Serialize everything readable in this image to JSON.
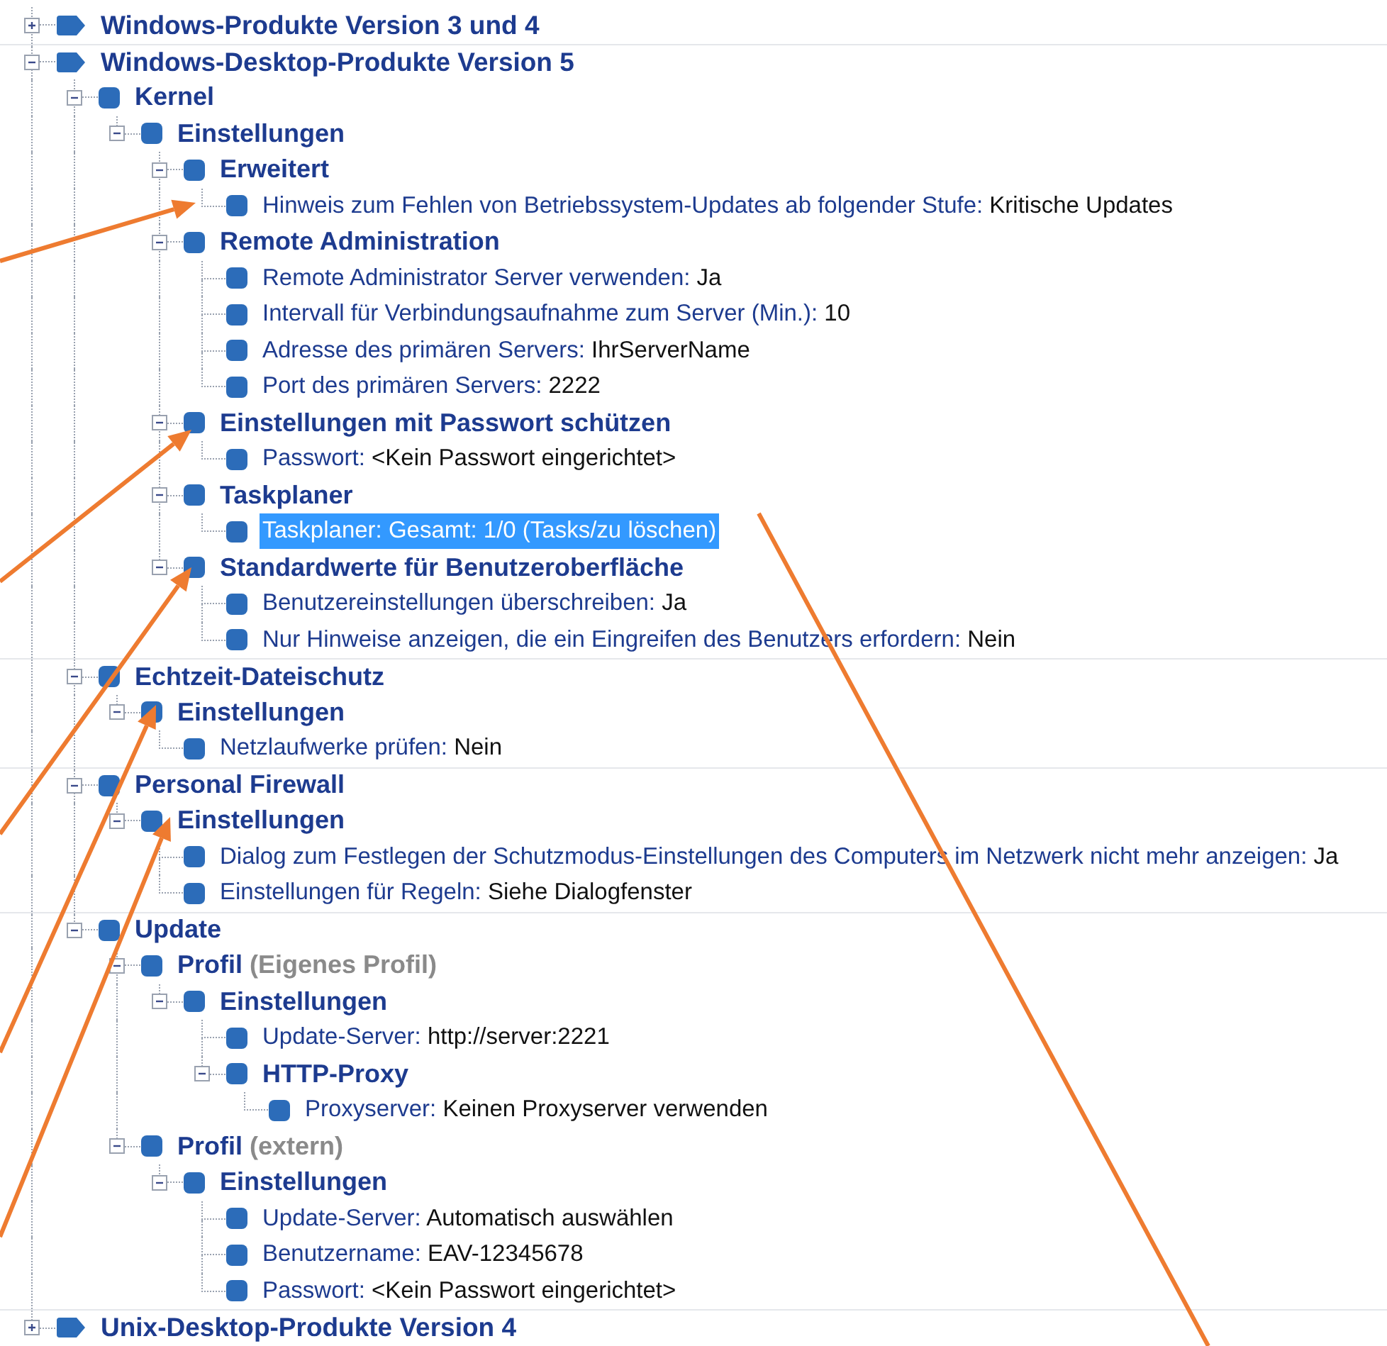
{
  "tree": [
    {
      "kind": "product",
      "label": "Windows-Produkte Version 3 und 4",
      "expanded": false,
      "selected": false
    },
    {
      "kind": "product",
      "label": "Windows-Desktop-Produkte Version 5",
      "expanded": true,
      "selected": false,
      "children": [
        {
          "kind": "group",
          "label": "Kernel",
          "expanded": true,
          "selected": false,
          "children": [
            {
              "kind": "group",
              "label": "Einstellungen",
              "expanded": true,
              "selected": false,
              "children": [
                {
                  "kind": "group",
                  "label": "Erweitert",
                  "expanded": true,
                  "selected": false,
                  "children": [
                    {
                      "kind": "setting",
                      "label": "Hinweis zum Fehlen von Betriebssystem-Updates ab folgender Stufe:",
                      "value": "Kritische Updates",
                      "selected": false
                    }
                  ]
                },
                {
                  "kind": "group",
                  "label": "Remote Administration",
                  "expanded": true,
                  "selected": false,
                  "children": [
                    {
                      "kind": "setting",
                      "label": "Remote Administrator Server verwenden:",
                      "value": "Ja",
                      "selected": false
                    },
                    {
                      "kind": "setting",
                      "label": "Intervall für Verbindungsaufnahme zum Server (Min.):",
                      "value": "10",
                      "selected": false
                    },
                    {
                      "kind": "setting",
                      "label": "Adresse des primären Servers:",
                      "value": "IhrServerName",
                      "selected": false
                    },
                    {
                      "kind": "setting",
                      "label": "Port des primären Servers:",
                      "value": "2222",
                      "selected": false
                    }
                  ]
                },
                {
                  "kind": "group",
                  "label": "Einstellungen mit Passwort schützen",
                  "expanded": true,
                  "selected": false,
                  "children": [
                    {
                      "kind": "setting",
                      "label": "Passwort:",
                      "value": "<Kein Passwort eingerichtet>",
                      "selected": false
                    }
                  ]
                },
                {
                  "kind": "group",
                  "label": "Taskplaner",
                  "expanded": true,
                  "selected": false,
                  "children": [
                    {
                      "kind": "setting",
                      "label": "Taskplaner:",
                      "value": "Gesamt: 1/0 (Tasks/zu löschen)",
                      "selected": true
                    }
                  ]
                },
                {
                  "kind": "group",
                  "label": "Standardwerte für Benutzeroberfläche",
                  "expanded": true,
                  "selected": false,
                  "children": [
                    {
                      "kind": "setting",
                      "label": "Benutzereinstellungen überschreiben:",
                      "value": "Ja",
                      "selected": false
                    },
                    {
                      "kind": "setting",
                      "label": "Nur Hinweise anzeigen, die ein Eingreifen des Benutzers erfordern:",
                      "value": "Nein",
                      "selected": false
                    }
                  ]
                }
              ]
            }
          ]
        },
        {
          "kind": "group",
          "label": "Echtzeit-Dateischutz",
          "expanded": true,
          "selected": false,
          "children": [
            {
              "kind": "group",
              "label": "Einstellungen",
              "expanded": true,
              "selected": false,
              "children": [
                {
                  "kind": "setting",
                  "label": "Netzlaufwerke prüfen:",
                  "value": "Nein",
                  "selected": false
                }
              ]
            }
          ]
        },
        {
          "kind": "group",
          "label": "Personal Firewall",
          "expanded": true,
          "selected": false,
          "children": [
            {
              "kind": "group",
              "label": "Einstellungen",
              "expanded": true,
              "selected": false,
              "children": [
                {
                  "kind": "setting",
                  "label": "Dialog zum Festlegen der Schutzmodus-Einstellungen des Computers im Netzwerk nicht mehr anzeigen:",
                  "value": "Ja",
                  "selected": false
                },
                {
                  "kind": "setting",
                  "label": "Einstellungen für Regeln:",
                  "value": "Siehe Dialogfenster",
                  "selected": false
                }
              ]
            }
          ]
        },
        {
          "kind": "group",
          "label": "Update",
          "expanded": true,
          "selected": false,
          "children": [
            {
              "kind": "group",
              "label": "Profil",
              "suffix": "(Eigenes Profil)",
              "expanded": true,
              "selected": false,
              "children": [
                {
                  "kind": "group",
                  "label": "Einstellungen",
                  "expanded": true,
                  "selected": false,
                  "children": [
                    {
                      "kind": "setting",
                      "label": "Update-Server:",
                      "value": "http://server:2221",
                      "selected": false
                    },
                    {
                      "kind": "group",
                      "label": "HTTP-Proxy",
                      "expanded": true,
                      "selected": false,
                      "children": [
                        {
                          "kind": "setting",
                          "label": "Proxyserver:",
                          "value": "Keinen Proxyserver verwenden",
                          "selected": false
                        }
                      ]
                    }
                  ]
                }
              ]
            },
            {
              "kind": "group",
              "label": "Profil",
              "suffix": "(extern)",
              "expanded": true,
              "selected": false,
              "children": [
                {
                  "kind": "group",
                  "label": "Einstellungen",
                  "expanded": true,
                  "selected": false,
                  "children": [
                    {
                      "kind": "setting",
                      "label": "Update-Server:",
                      "value": "Automatisch auswählen",
                      "selected": false
                    },
                    {
                      "kind": "setting",
                      "label": "Benutzername:",
                      "value": "EAV-12345678",
                      "selected": false
                    },
                    {
                      "kind": "setting",
                      "label": "Passwort:",
                      "value": "<Kein Passwort eingerichtet>",
                      "selected": false
                    }
                  ]
                }
              ]
            }
          ]
        }
      ]
    },
    {
      "kind": "product",
      "label": "Unix-Desktop-Produkte Version 4",
      "expanded": false,
      "selected": false
    }
  ]
}
